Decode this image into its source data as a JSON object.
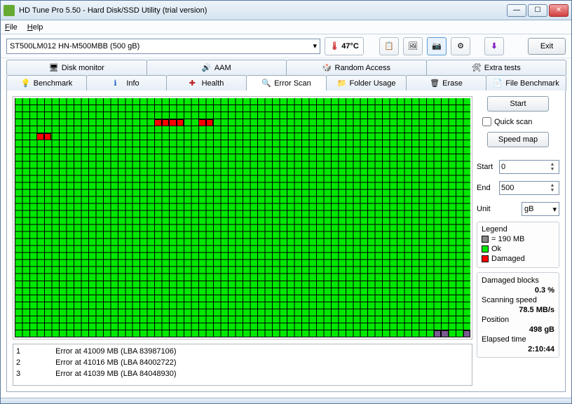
{
  "window": {
    "title": "HD Tune Pro 5.50 - Hard Disk/SSD Utility (trial version)"
  },
  "menu": {
    "file": "File",
    "help": "Help"
  },
  "toolbar": {
    "disk": "ST500LM012 HN-M500MBB (500 gB)",
    "temp": "47°C",
    "exit": "Exit",
    "icons": [
      "copy-icon",
      "screenshot-icon",
      "camera-icon",
      "options-icon",
      "download-icon"
    ]
  },
  "tabs_top": [
    {
      "label": "Disk monitor",
      "icon": "monitor"
    },
    {
      "label": "AAM",
      "icon": "speaker"
    },
    {
      "label": "Random Access",
      "icon": "dice"
    },
    {
      "label": "Extra tests",
      "icon": "tools"
    }
  ],
  "tabs_bottom": [
    {
      "label": "Benchmark",
      "icon": "bulb"
    },
    {
      "label": "Info",
      "icon": "info"
    },
    {
      "label": "Health",
      "icon": "health"
    },
    {
      "label": "Error Scan",
      "icon": "search",
      "active": true
    },
    {
      "label": "Folder Usage",
      "icon": "folder"
    },
    {
      "label": "Erase",
      "icon": "trash"
    },
    {
      "label": "File Benchmark",
      "icon": "file"
    }
  ],
  "controls": {
    "start": "Start",
    "quick_scan": "Quick scan",
    "speed_map": "Speed map",
    "start_label": "Start",
    "start_val": "0",
    "end_label": "End",
    "end_val": "500",
    "unit_label": "Unit",
    "unit_val": "gB"
  },
  "legend": {
    "title": "Legend",
    "block_size": "= 190 MB",
    "ok": "Ok",
    "damaged": "Damaged"
  },
  "stats": {
    "damaged_label": "Damaged blocks",
    "damaged_val": "0.3 %",
    "speed_label": "Scanning speed",
    "speed_val": "78.5 MB/s",
    "pos_label": "Position",
    "pos_val": "498 gB",
    "elapsed_label": "Elapsed time",
    "elapsed_val": "2:10:44"
  },
  "errors": [
    {
      "n": "1",
      "msg": "Error at 41009 MB (LBA 83987106)"
    },
    {
      "n": "2",
      "msg": "Error at 41016 MB (LBA 84002722)"
    },
    {
      "n": "3",
      "msg": "Error at 41039 MB (LBA 84048930)"
    }
  ],
  "grid": {
    "cols": 62,
    "rows": 34
  },
  "chart_data": {
    "type": "heatmap",
    "unit": "block (190 MB each)",
    "cols": 62,
    "rows": 34,
    "states": {
      "0": "ok",
      "1": "damaged",
      "2": "purple"
    },
    "legend": {
      "ok": "#00e800",
      "damaged": "#ff0000",
      "purple": "#7a5a90"
    },
    "damaged_cells": [
      {
        "row": 3,
        "col": 19
      },
      {
        "row": 3,
        "col": 20
      },
      {
        "row": 3,
        "col": 21
      },
      {
        "row": 3,
        "col": 22
      },
      {
        "row": 3,
        "col": 25
      },
      {
        "row": 3,
        "col": 26
      },
      {
        "row": 5,
        "col": 3
      },
      {
        "row": 5,
        "col": 4
      }
    ],
    "purple_cells": [
      {
        "row": 33,
        "col": 57
      },
      {
        "row": 33,
        "col": 58
      },
      {
        "row": 33,
        "col": 61
      }
    ]
  }
}
